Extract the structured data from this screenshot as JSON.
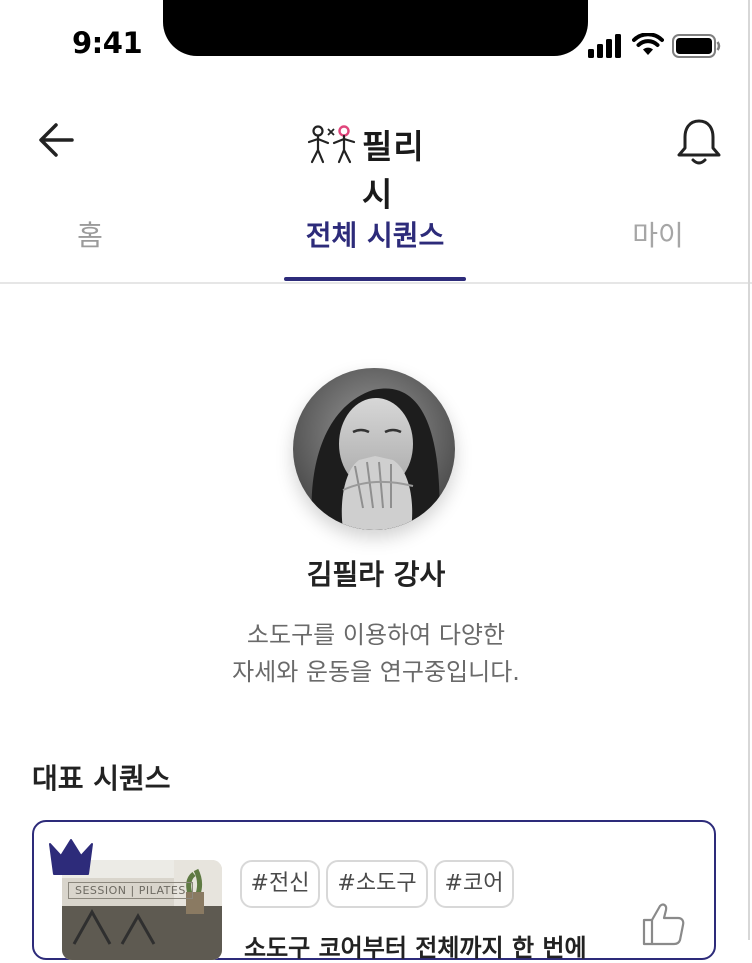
{
  "status_bar": {
    "time": "9:41",
    "icons": [
      "signal-icon",
      "wifi-icon",
      "battery-icon"
    ]
  },
  "app_bar": {
    "logo_text": "필리시",
    "icons": [
      "back-arrow-icon",
      "logo-figures-icon",
      "bell-icon"
    ]
  },
  "tabs": [
    {
      "label": "홈",
      "active": false
    },
    {
      "label": "전체 시퀀스",
      "active": true
    },
    {
      "label": "마이",
      "active": false
    }
  ],
  "profile": {
    "name": "김필라 강사",
    "bio_line1": "소도구를 이용하여 다양한",
    "bio_line2": "자세와 운동을 연구중입니다."
  },
  "featured": {
    "section_title": "대표 시퀀스",
    "card": {
      "tags": [
        "#전신",
        "#소도구",
        "#코어"
      ],
      "title": "소도구 코어부터 전체까지 한 번에",
      "thumbnail_caption": "SESSION | PILATES",
      "icons": [
        "crown-icon",
        "thumbs-up-icon"
      ]
    }
  },
  "colors": {
    "primary": "#2d2b7a",
    "inactive_tab": "#9b9b9b",
    "bio_text": "#6a6a6a",
    "logo_pink": "#e0457b"
  }
}
